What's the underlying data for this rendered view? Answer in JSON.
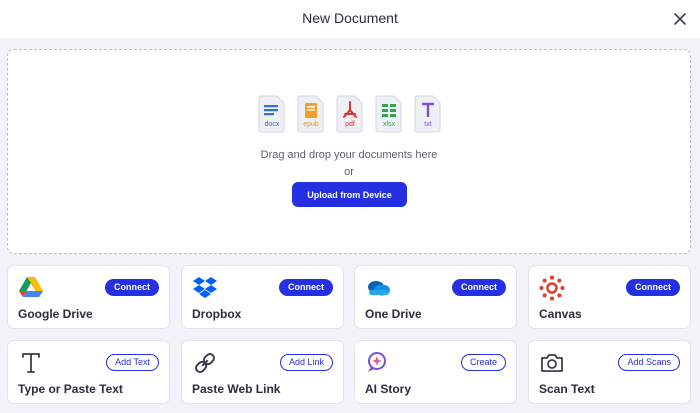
{
  "header": {
    "title": "New Document"
  },
  "dropzone": {
    "file_types": [
      "docx",
      "epub",
      "pdf",
      "xlsx",
      "txt"
    ],
    "drag_text": "Drag and drop your documents here",
    "or_text": "or",
    "upload_label": "Upload from Device"
  },
  "sources": [
    {
      "label": "Google Drive",
      "action": "Connect",
      "icon": "google-drive-icon"
    },
    {
      "label": "Dropbox",
      "action": "Connect",
      "icon": "dropbox-icon"
    },
    {
      "label": "One Drive",
      "action": "Connect",
      "icon": "onedrive-icon"
    },
    {
      "label": "Canvas",
      "action": "Connect",
      "icon": "canvas-icon"
    }
  ],
  "tools": [
    {
      "label": "Type or Paste Text",
      "action": "Add Text",
      "icon": "text-icon"
    },
    {
      "label": "Paste Web Link",
      "action": "Add Link",
      "icon": "link-icon"
    },
    {
      "label": "AI Story",
      "action": "Create",
      "icon": "ai-story-icon"
    },
    {
      "label": "Scan Text",
      "action": "Add Scans",
      "icon": "camera-icon"
    }
  ],
  "colors": {
    "accent": "#2430e2",
    "background": "#f1f3f8"
  }
}
